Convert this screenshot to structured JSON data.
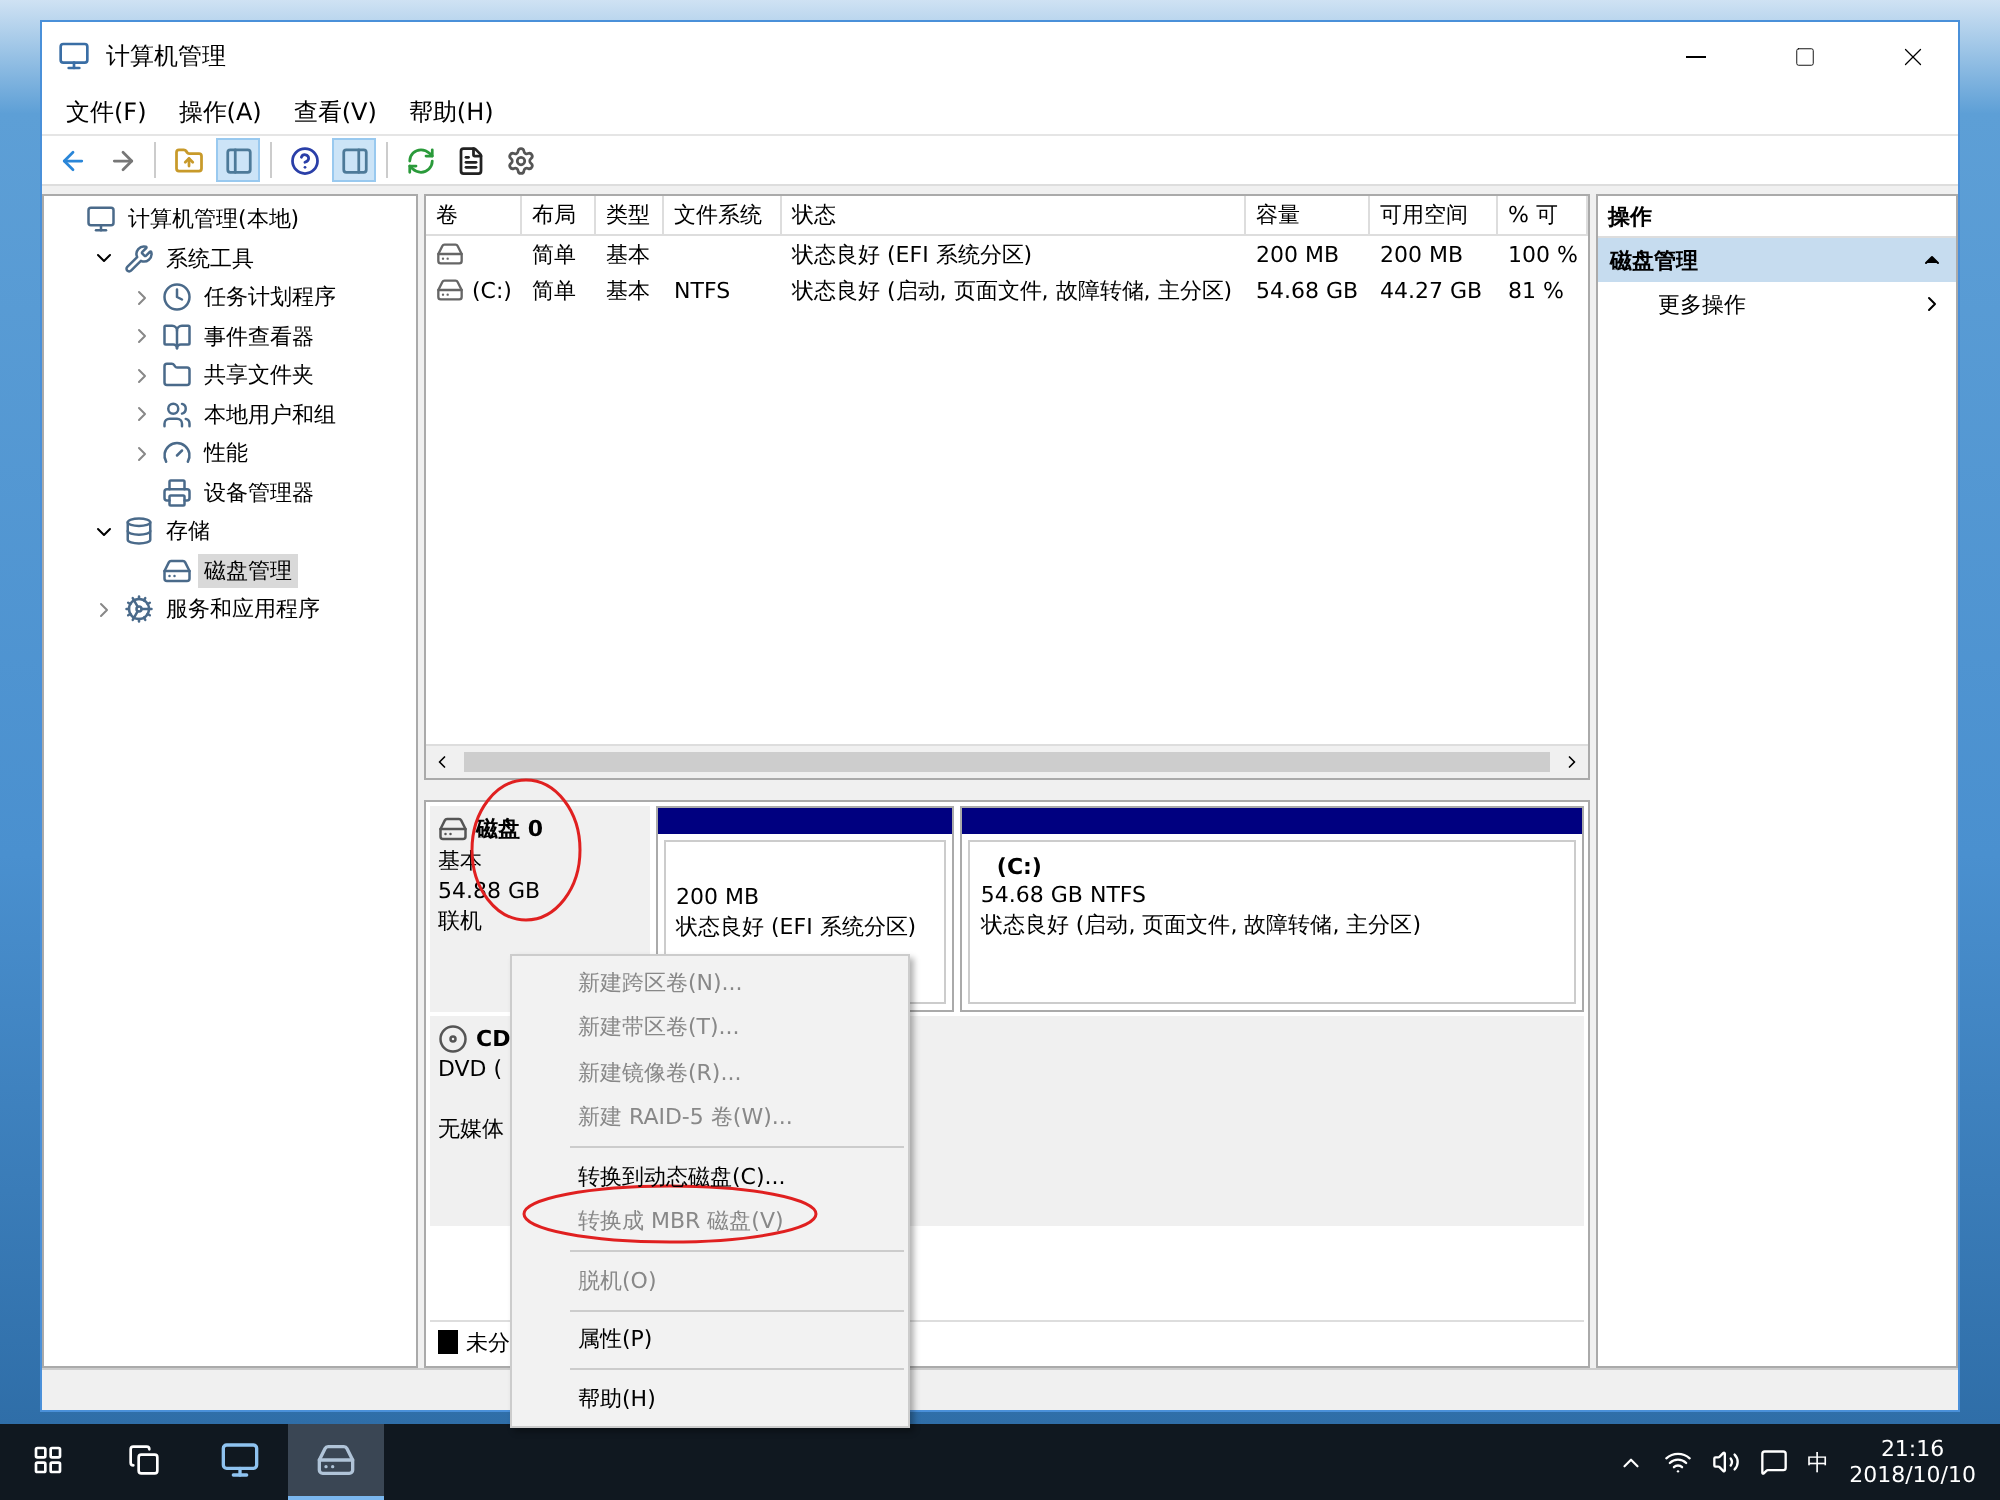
{
  "window": {
    "title": "计算机管理"
  },
  "menu": [
    "文件(F)",
    "操作(A)",
    "查看(V)",
    "帮助(H)"
  ],
  "toolbar": [
    {
      "kind": "back",
      "pressed": false
    },
    {
      "kind": "forward",
      "pressed": false
    },
    {
      "kind": "sep"
    },
    {
      "kind": "up",
      "pressed": false
    },
    {
      "kind": "tree",
      "pressed": true
    },
    {
      "kind": "sep"
    },
    {
      "kind": "help",
      "pressed": false
    },
    {
      "kind": "pane",
      "pressed": true
    },
    {
      "kind": "sep"
    },
    {
      "kind": "refresh",
      "pressed": false
    },
    {
      "kind": "props",
      "pressed": false
    },
    {
      "kind": "settings",
      "pressed": false
    }
  ],
  "tree": [
    {
      "label": "计算机管理(本地)",
      "kind": "computer",
      "selected": false,
      "children": [
        {
          "label": "系统工具",
          "kind": "tools",
          "expanded": true,
          "selected": false,
          "children": [
            {
              "label": "任务计划程序",
              "kind": "clock",
              "expanded": false,
              "selected": false
            },
            {
              "label": "事件查看器",
              "kind": "log",
              "expanded": false,
              "selected": false
            },
            {
              "label": "共享文件夹",
              "kind": "folder",
              "expanded": false,
              "selected": false
            },
            {
              "label": "本地用户和组",
              "kind": "users",
              "expanded": false,
              "selected": false
            },
            {
              "label": "性能",
              "kind": "gauge",
              "expanded": false,
              "selected": false
            },
            {
              "label": "设备管理器",
              "kind": "device",
              "selected": false
            }
          ]
        },
        {
          "label": "存储",
          "kind": "storage",
          "expanded": true,
          "selected": false,
          "children": [
            {
              "label": "磁盘管理",
              "kind": "disk",
              "selected": true
            }
          ]
        },
        {
          "label": "服务和应用程序",
          "kind": "services",
          "expanded": false,
          "selected": false
        }
      ]
    }
  ],
  "table": {
    "columns": [
      "卷",
      "布局",
      "类型",
      "文件系统",
      "状态",
      "容量",
      "可用空间",
      "% 可"
    ],
    "rows": [
      {
        "layout": "简单",
        "type": "基本",
        "status": "状态良好 (EFI 系统分区)",
        "capacity": "200 MB",
        "free": "200 MB",
        "pct_free": "100 %"
      },
      {
        "volume": "(C:)",
        "layout": "简单",
        "type": "基本",
        "filesystem": "NTFS",
        "status": "状态良好 (启动, 页面文件, 故障转储, 主分区)",
        "capacity": "54.68 GB",
        "free": "44.27 GB",
        "pct_free": "81 %"
      }
    ]
  },
  "disks": [
    {
      "kind": "disk",
      "name": "磁盘 0",
      "type": "基本",
      "size": "54.88 GB",
      "state": "联机",
      "partitions": [
        {
          "size": "200 MB",
          "status": "状态良好 (EFI 系统分区)"
        },
        {
          "label": "(C:)",
          "size": "54.68 GB NTFS",
          "status": "状态良好 (启动, 页面文件, 故障转储, 主分区)"
        }
      ]
    },
    {
      "kind": "cdrom",
      "name": "CD",
      "type": "DVD (",
      "state": "无媒体"
    }
  ],
  "legend": [
    {
      "label": "未分",
      "color": "#000000"
    }
  ],
  "context_menu": [
    {
      "kind": "item",
      "label": "新建跨区卷(N)...",
      "disabled": true
    },
    {
      "kind": "item",
      "label": "新建带区卷(T)...",
      "disabled": true
    },
    {
      "kind": "item",
      "label": "新建镜像卷(R)...",
      "disabled": true
    },
    {
      "kind": "item",
      "label": "新建 RAID-5 卷(W)...",
      "disabled": true
    },
    {
      "kind": "separator"
    },
    {
      "kind": "item",
      "label": "转换到动态磁盘(C)...",
      "disabled": false
    },
    {
      "kind": "item",
      "label": "转换成 MBR 磁盘(V)",
      "disabled": true
    },
    {
      "kind": "separator"
    },
    {
      "kind": "item",
      "label": "脱机(O)",
      "disabled": true
    },
    {
      "kind": "separator"
    },
    {
      "kind": "item",
      "label": "属性(P)",
      "disabled": false
    },
    {
      "kind": "separator"
    },
    {
      "kind": "item",
      "label": "帮助(H)",
      "disabled": false
    }
  ],
  "actions": {
    "header": "操作",
    "section": "磁盘管理",
    "items": [
      "更多操作"
    ]
  },
  "taskbar": {
    "apps": [
      {
        "kind": "computer",
        "selected": false
      },
      {
        "kind": "diskmgmt",
        "selected": true
      }
    ],
    "ime": "中",
    "time": "21:16",
    "date": "2018/10/10"
  }
}
